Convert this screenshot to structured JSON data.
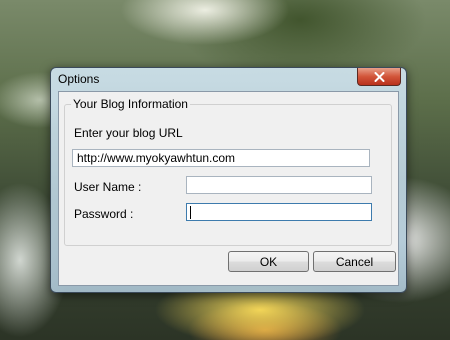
{
  "window": {
    "title": "Options"
  },
  "group": {
    "title": "Your Blog Information"
  },
  "form": {
    "url_label": "Enter your blog URL",
    "url_value": "http://www.myokyawhtun.com",
    "username_label": "User Name :",
    "username_value": "",
    "password_label": "Password :",
    "password_value": ""
  },
  "buttons": {
    "ok": "OK",
    "cancel": "Cancel"
  },
  "colors": {
    "close_button": "#d2553a",
    "dialog_face": "#f0f0f0",
    "focus_border": "#3d7bad"
  }
}
